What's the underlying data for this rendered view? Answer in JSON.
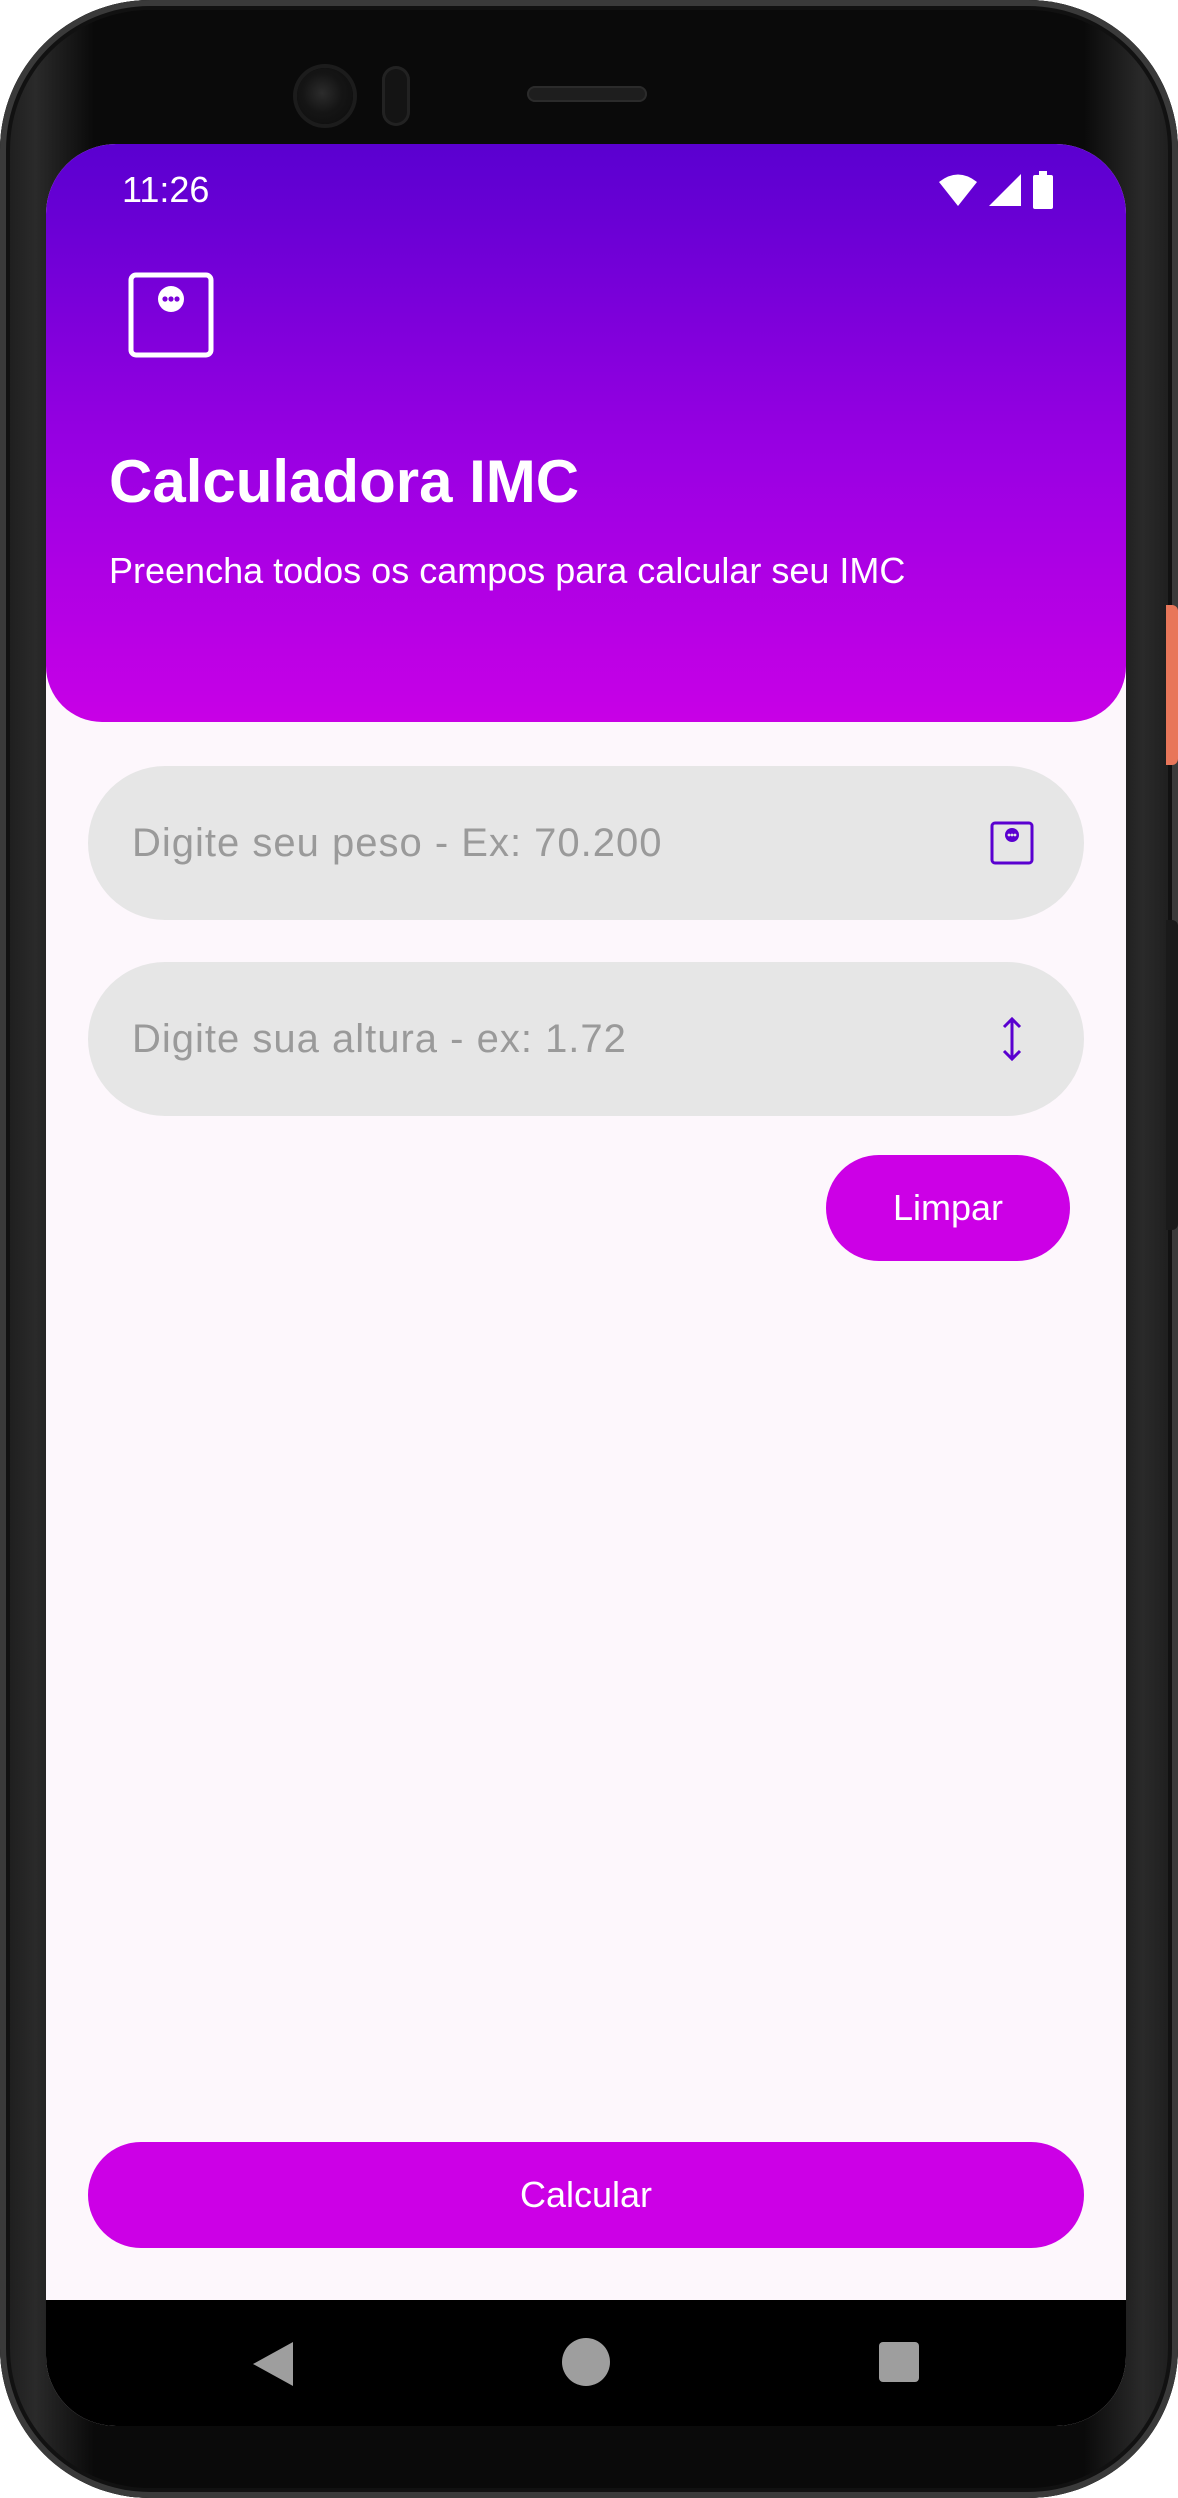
{
  "status_bar": {
    "time": "11:26",
    "icons": [
      "wifi-icon",
      "cell-signal-icon",
      "battery-icon"
    ]
  },
  "header": {
    "app_icon": "scale-icon",
    "title": "Calculadora IMC",
    "subtitle": "Preencha todos os campos para calcular seu IMC"
  },
  "form": {
    "weight": {
      "placeholder": "Digite seu peso - Ex: 70.200",
      "value": "",
      "icon": "scale-icon"
    },
    "height": {
      "placeholder": "Digite sua altura - ex: 1.72",
      "value": "",
      "icon": "vertical-arrows-icon"
    },
    "clear_label": "Limpar",
    "calculate_label": "Calcular"
  },
  "nav_bar": {
    "icons": [
      "back-icon",
      "home-icon",
      "recents-icon"
    ]
  },
  "colors": {
    "header_gradient_top": "#5a00d0",
    "header_gradient_bottom": "#c800e6",
    "accent": "#cc00e6",
    "icon_accent": "#5a00d0",
    "field_bg": "#e6e6e6",
    "screen_bg": "#fdf7fc"
  }
}
